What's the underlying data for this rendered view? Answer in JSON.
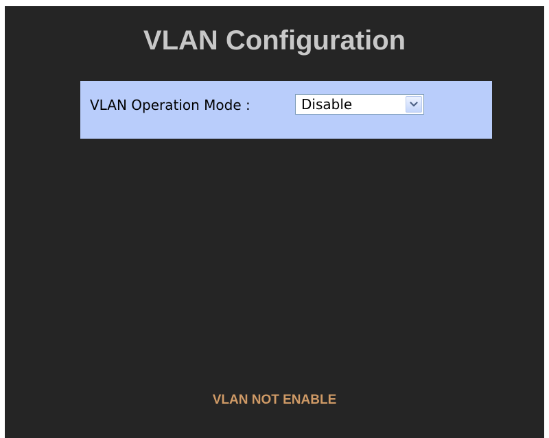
{
  "page": {
    "title": "VLAN Configuration"
  },
  "vlan_mode": {
    "label": "VLAN Operation Mode :",
    "selected": "Disable"
  },
  "status": {
    "message": "VLAN NOT ENABLE"
  },
  "icons": {
    "dropdown": "chevron-down-icon"
  },
  "colors": {
    "background": "#252525",
    "title": "#c8c8c8",
    "panel": "#b9cdfb",
    "status_text": "#cf9a66",
    "select_border": "#7f9db9"
  }
}
